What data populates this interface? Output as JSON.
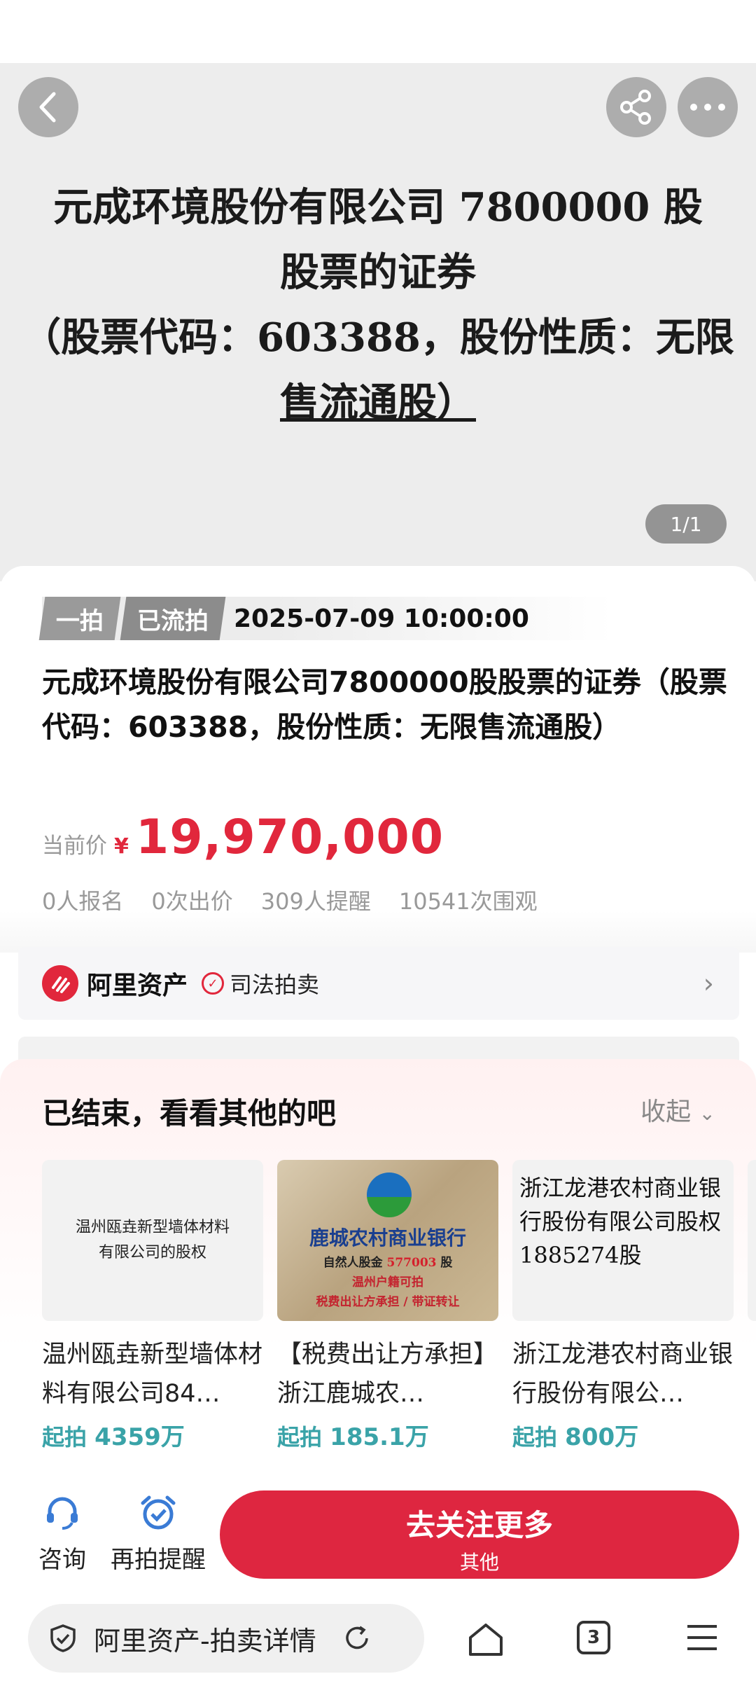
{
  "hero": {
    "line1": "元成环境股份有限公司 7800000 股",
    "line2": "股票的证券",
    "line3": "（股票代码：603388，股份性质：无限",
    "line4": "售流通股）",
    "pager": "1/1"
  },
  "auction": {
    "tag1": "一拍",
    "tag2": "已流拍",
    "time": "2025-07-09 10:00:00",
    "title": "元成环境股份有限公司7800000股股票的证券（股票代码：603388，股份性质：无限售流通股）",
    "price_label": "当前价",
    "price_symbol": "¥",
    "price": "19,970,000",
    "stats": [
      "0人报名",
      "0次出价",
      "309人提醒",
      "10541次围观"
    ]
  },
  "platform": {
    "name": "阿里资产",
    "tag": "司法拍卖"
  },
  "sheet": {
    "title": "已结束，看看其他的吧",
    "collapse": "收起",
    "items": [
      {
        "img_text1": "温州瓯垚新型墙体材料",
        "img_text2": "有限公司的股权",
        "name": "温州瓯垚新型墙体材料有限公司84…",
        "price_prefix": "起拍",
        "price": "4359万"
      },
      {
        "img_text1": "鹿城农村商业银行",
        "img_text2": "自然人股金",
        "img_text3": "577003",
        "img_text4": "股",
        "img_text5": "温州户籍可拍",
        "img_text6": "税费出让方承担 / 带证转让",
        "name": "【税费出让方承担】浙江鹿城农…",
        "price_prefix": "起拍",
        "price": "185.1万"
      },
      {
        "img_text1": "浙江龙港农村商业银行股份有限公司股权1885274股",
        "name": "浙江龙港农村商业银行股份有限公…",
        "price_prefix": "起拍",
        "price": "800万"
      }
    ]
  },
  "bottom": {
    "consult": "咨询",
    "remind": "再拍提醒",
    "cta": "去关注更多",
    "cta_sub": "其他"
  },
  "browser": {
    "url_text": "阿里资产-拍卖详情",
    "tab_count": "3"
  },
  "colors": {
    "accent_red": "#de2640",
    "price_red": "#e1273c",
    "teal": "#3aa3a8"
  }
}
